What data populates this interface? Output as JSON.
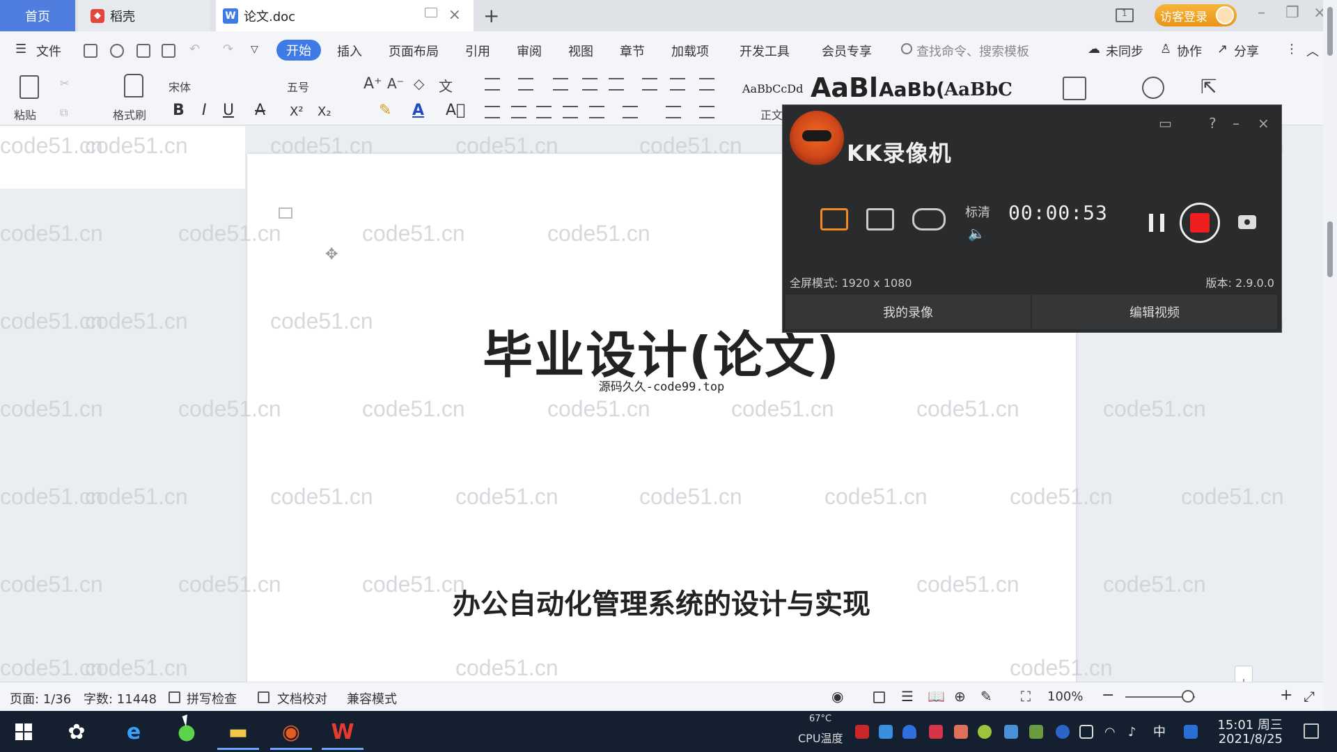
{
  "tabs": {
    "home": "首页",
    "daoke": "稻壳",
    "doc": "论文.doc",
    "daoke_icon": "daoke-logo-icon",
    "doc_icon": "wps-writer-icon"
  },
  "titlebar": {
    "visitor_login": "访客登录",
    "layout_badge": "1"
  },
  "menu": {
    "file": "文件",
    "items": [
      "开始",
      "插入",
      "页面布局",
      "引用",
      "审阅",
      "视图",
      "章节",
      "加载项",
      "开发工具",
      "会员专享"
    ],
    "search": "查找命令、搜索模板",
    "unsynced": "未同步",
    "collab": "协作",
    "share": "分享"
  },
  "ribbon": {
    "paste": "粘贴",
    "format_painter": "格式刷",
    "font_name": "宋体",
    "font_size": "五号",
    "bold": "B",
    "italic": "I",
    "underline": "U",
    "strike": "A",
    "style_normal": "正文",
    "style_samples": [
      "AaBbCcDd",
      "AaBl",
      "AaBb(",
      "AaBbC"
    ],
    "accent_color": "#3f7ae6"
  },
  "document": {
    "title": "毕业设计(论文)",
    "subtitle": "源码久久-code99.top",
    "topic": "办公自动化管理系统的设计与实现",
    "watermark": "code51.cn"
  },
  "statusbar": {
    "page": "页面: 1/36",
    "words": "字数: 11448",
    "spellcheck": "拼写检查",
    "proofread": "文档校对",
    "compat": "兼容模式",
    "zoom": "100%",
    "zoom_level": 0.9
  },
  "recorder": {
    "title": "KK录像机",
    "quality": "标清",
    "timer": "00:00:53",
    "mode_text": "全屏模式: 1920 x 1080",
    "version": "版本: 2.9.0.0",
    "my_recordings": "我的录像",
    "edit_video": "编辑视频",
    "stop_color": "#ef1f1f",
    "active_mode_color": "#f08a24"
  },
  "taskbar": {
    "cpu_label": "CPU温度",
    "cpu_value": "67°C",
    "ime": "中",
    "time": "15:01 周三",
    "date": "2021/8/25",
    "apps": [
      "windows-start-icon",
      "pinwheel-app-icon",
      "internet-explorer-icon",
      "browser-green-icon",
      "file-explorer-icon",
      "kk-recorder-icon",
      "wps-office-icon"
    ]
  }
}
